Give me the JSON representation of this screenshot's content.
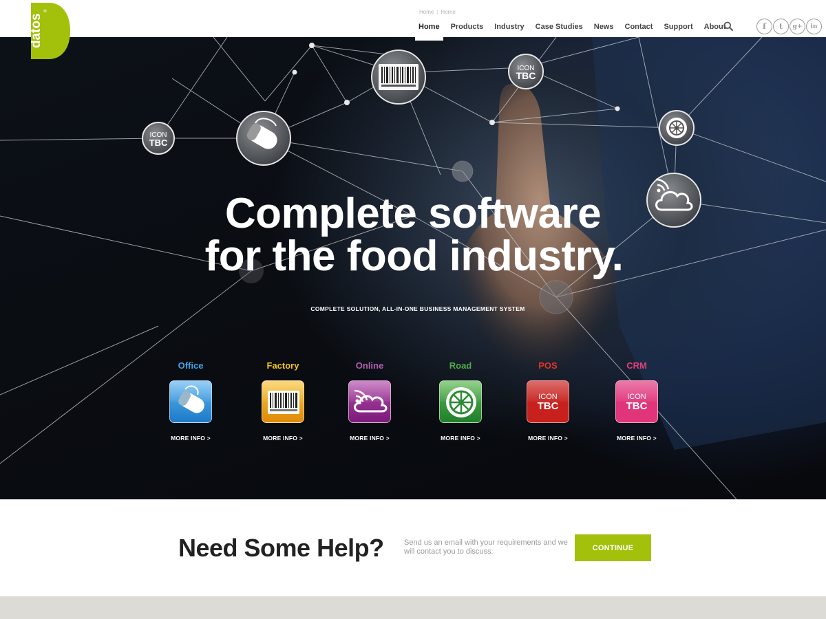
{
  "brand": {
    "logo_text": "datos",
    "logo_mark": "®",
    "accent": "#a3c00b"
  },
  "header": {
    "breadcrumb": [
      "Home",
      "Home"
    ],
    "nav": [
      {
        "label": "Home",
        "active": true
      },
      {
        "label": "Products"
      },
      {
        "label": "Industry"
      },
      {
        "label": "Case Studies"
      },
      {
        "label": "News"
      },
      {
        "label": "Contact"
      },
      {
        "label": "Support"
      },
      {
        "label": "About"
      }
    ],
    "search_icon": "search-icon",
    "social": [
      {
        "icon": "facebook-icon",
        "glyph": "f"
      },
      {
        "icon": "twitter-icon",
        "glyph": "t"
      },
      {
        "icon": "google-plus-icon",
        "glyph": "g+"
      },
      {
        "icon": "linkedin-icon",
        "glyph": "in"
      }
    ]
  },
  "hero": {
    "headline_line1": "Complete software",
    "headline_line2": "for the food industry.",
    "subheadline": "COMPLETE SOLUTION, ALL-IN-ONE BUSINESS MANAGEMENT SYSTEM",
    "floating_icons": [
      {
        "icon": "barcode-icon"
      },
      {
        "icon": "icon-tbc",
        "text_a": "ICON",
        "text_b": "TBC"
      },
      {
        "icon": "mouse-icon"
      },
      {
        "icon": "icon-tbc",
        "text_a": "ICON",
        "text_b": "TBC"
      },
      {
        "icon": "wheel-icon"
      },
      {
        "icon": "cloud-icon"
      }
    ]
  },
  "products": [
    {
      "name": "Office",
      "color": "#3aa6e8",
      "icon": "mouse-icon",
      "more": "MORE INFO >"
    },
    {
      "name": "Factory",
      "color": "#f2c320",
      "icon": "barcode-icon",
      "more": "MORE INFO >"
    },
    {
      "name": "Online",
      "color": "#b55fb0",
      "icon": "cloud-icon",
      "more": "MORE INFO >"
    },
    {
      "name": "Road",
      "color": "#4cae4c",
      "icon": "wheel-icon",
      "more": "MORE INFO >"
    },
    {
      "name": "POS",
      "color": "#e0342b",
      "icon": "icon-tbc",
      "tile_a": "ICON",
      "tile_b": "TBC",
      "more": "MORE INFO >"
    },
    {
      "name": "CRM",
      "color": "#e23f7c",
      "icon": "icon-tbc",
      "tile_a": "ICON",
      "tile_b": "TBC",
      "more": "MORE INFO >"
    }
  ],
  "help": {
    "title": "Need Some Help?",
    "text": "Send us an email with your requirements and we will contact you to discuss.",
    "button": "CONTINUE"
  }
}
